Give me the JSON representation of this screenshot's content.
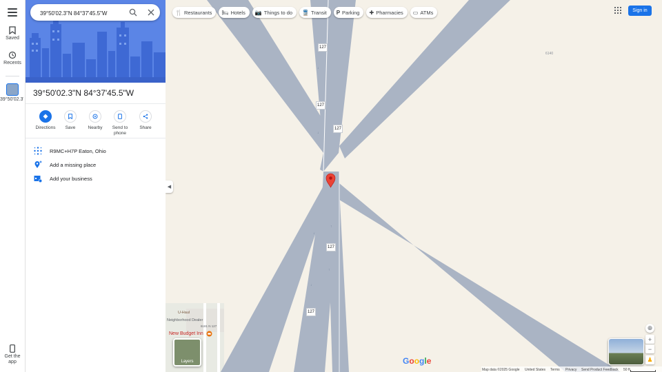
{
  "search": {
    "value": "39°50'02.3\"N 84°37'45.5\"W"
  },
  "rail": {
    "saved": "Saved",
    "recents": "Recents",
    "recent_item": "39°50'02.3\"N",
    "get_app": "Get the app"
  },
  "place": {
    "title": "39°50'02.3\"N 84°37'45.5\"W",
    "actions": [
      {
        "label": "Directions"
      },
      {
        "label": "Save"
      },
      {
        "label": "Nearby"
      },
      {
        "label": "Send to phone"
      },
      {
        "label": "Share"
      }
    ],
    "plus_code": "R9MC+H7P Eaton, Ohio",
    "add_missing": "Add a missing place",
    "add_business": "Add your business"
  },
  "chips": [
    {
      "label": "Restaurants",
      "icon": "fork-knife-icon"
    },
    {
      "label": "Hotels",
      "icon": "bed-icon"
    },
    {
      "label": "Things to do",
      "icon": "camera-icon"
    },
    {
      "label": "Transit",
      "icon": "train-icon"
    },
    {
      "label": "Parking",
      "icon": "parking-icon"
    },
    {
      "label": "Pharmacies",
      "icon": "pharmacy-icon"
    },
    {
      "label": "ATMs",
      "icon": "atm-icon"
    }
  ],
  "header": {
    "sign_in": "Sign in"
  },
  "map": {
    "route_label": "127",
    "road_label": "6140",
    "poi_budget_inn": "New Budget Inn",
    "poi_dealer": "Neighborhood Dealer",
    "poi_uhaul": "U-Haul",
    "poi_dealer_addr": "6181 N 127",
    "layers": "Layers",
    "google": "Google"
  },
  "footer": {
    "map_data": "Map data ©2025 Google",
    "country": "United States",
    "terms": "Terms",
    "privacy": "Privacy",
    "feedback": "Send Product Feedback",
    "scale": "50 ft"
  },
  "colors": {
    "accent": "#1a73e8",
    "pin": "#ea4335",
    "road": "#aab4c4"
  }
}
